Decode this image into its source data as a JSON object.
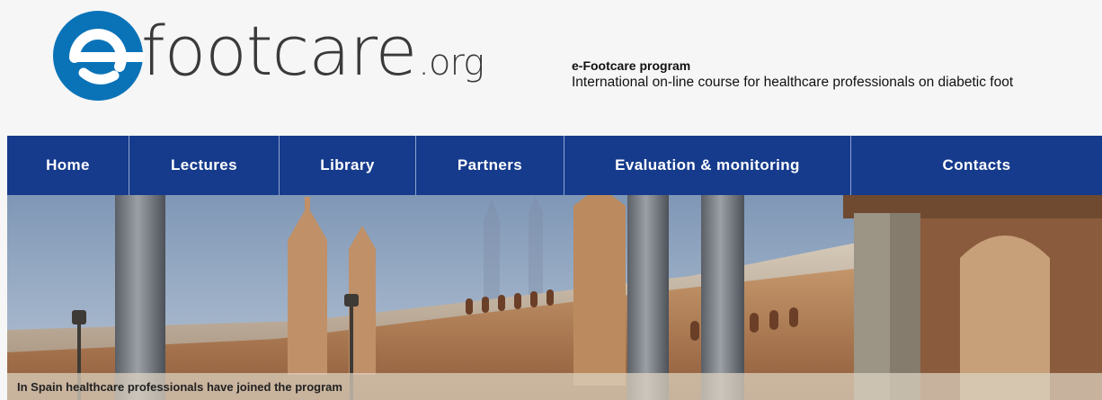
{
  "logo": {
    "word": "footcare",
    "tld": ".org",
    "mark_letter": "e",
    "brand_color": "#0a73b8"
  },
  "tagline": {
    "title": "e-Footcare program",
    "subtitle": "International on-line course for healthcare professionals on diabetic foot"
  },
  "nav": {
    "background": "#163b8c",
    "items": [
      "Home",
      "Lectures",
      "Library",
      "Partners",
      "Evaluation & monitoring",
      "Contacts"
    ]
  },
  "hero": {
    "caption": "In Spain healthcare professionals have joined the program"
  }
}
